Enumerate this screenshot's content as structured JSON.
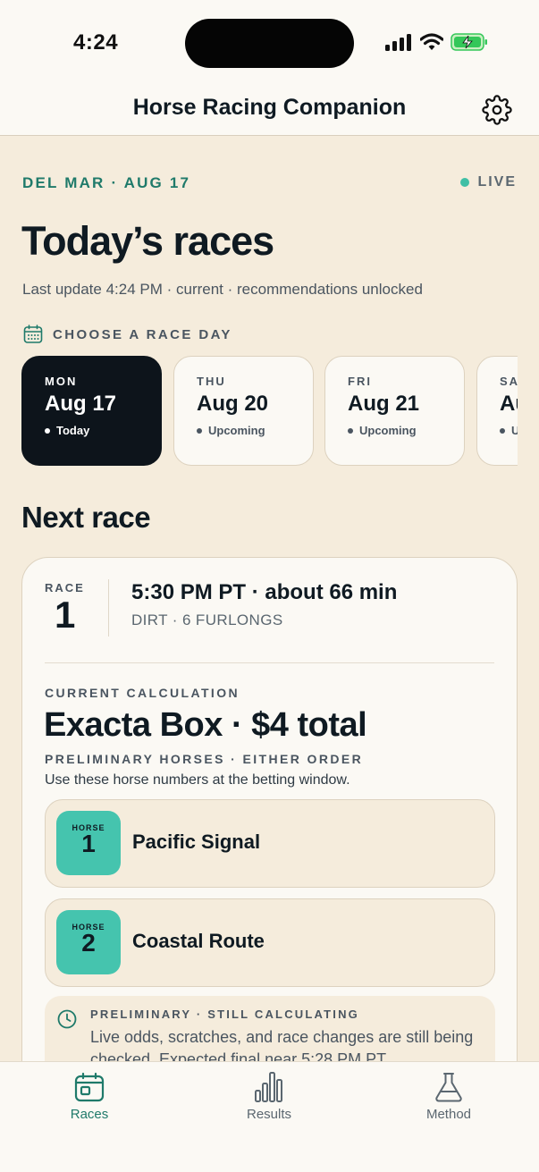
{
  "status_bar": {
    "time": "4:24"
  },
  "header": {
    "title": "Horse Racing Companion"
  },
  "event": {
    "venue_date": "DEL MAR · AUG 17",
    "live_label": "LIVE",
    "title": "Today’s races",
    "last_update": "Last update 4:24 PM · current · recommendations unlocked"
  },
  "day_picker": {
    "label": "CHOOSE A RACE DAY",
    "days": [
      {
        "dow": "MON",
        "date": "Aug 17",
        "status": "Today",
        "selected": true
      },
      {
        "dow": "THU",
        "date": "Aug 20",
        "status": "Upcoming",
        "selected": false
      },
      {
        "dow": "FRI",
        "date": "Aug 21",
        "status": "Upcoming",
        "selected": false
      },
      {
        "dow": "SA",
        "date": "Au",
        "status": "U",
        "selected": false
      }
    ]
  },
  "next_race": {
    "section_title": "Next race",
    "race_label": "RACE",
    "race_number": "1",
    "post_time": "5:30 PM PT · about 66 min",
    "track": "DIRT · 6 FURLONGS",
    "calc_label": "CURRENT CALCULATION",
    "bet": "Exacta Box · $4 total",
    "prelim_label": "PRELIMINARY HORSES · EITHER ORDER",
    "instruction": "Use these horse numbers at the betting window.",
    "horse_word": "HORSE",
    "horses": [
      {
        "number": "1",
        "name": "Pacific Signal"
      },
      {
        "number": "2",
        "name": "Coastal Route"
      }
    ],
    "status_label": "PRELIMINARY · STILL CALCULATING",
    "status_text": "Live odds, scratches, and race changes are still being checked. Expected final near 5:28 PM PT."
  },
  "tabs": [
    {
      "label": "Races",
      "icon": "calendar-icon",
      "active": true
    },
    {
      "label": "Results",
      "icon": "bar-chart-icon",
      "active": false
    },
    {
      "label": "Method",
      "icon": "flask-icon",
      "active": false
    }
  ],
  "colors": {
    "accent": "#1f7a6a",
    "badge": "#45c4ae",
    "background": "#f5ecdc",
    "card": "#fbf9f4",
    "dark": "#0d141b"
  }
}
